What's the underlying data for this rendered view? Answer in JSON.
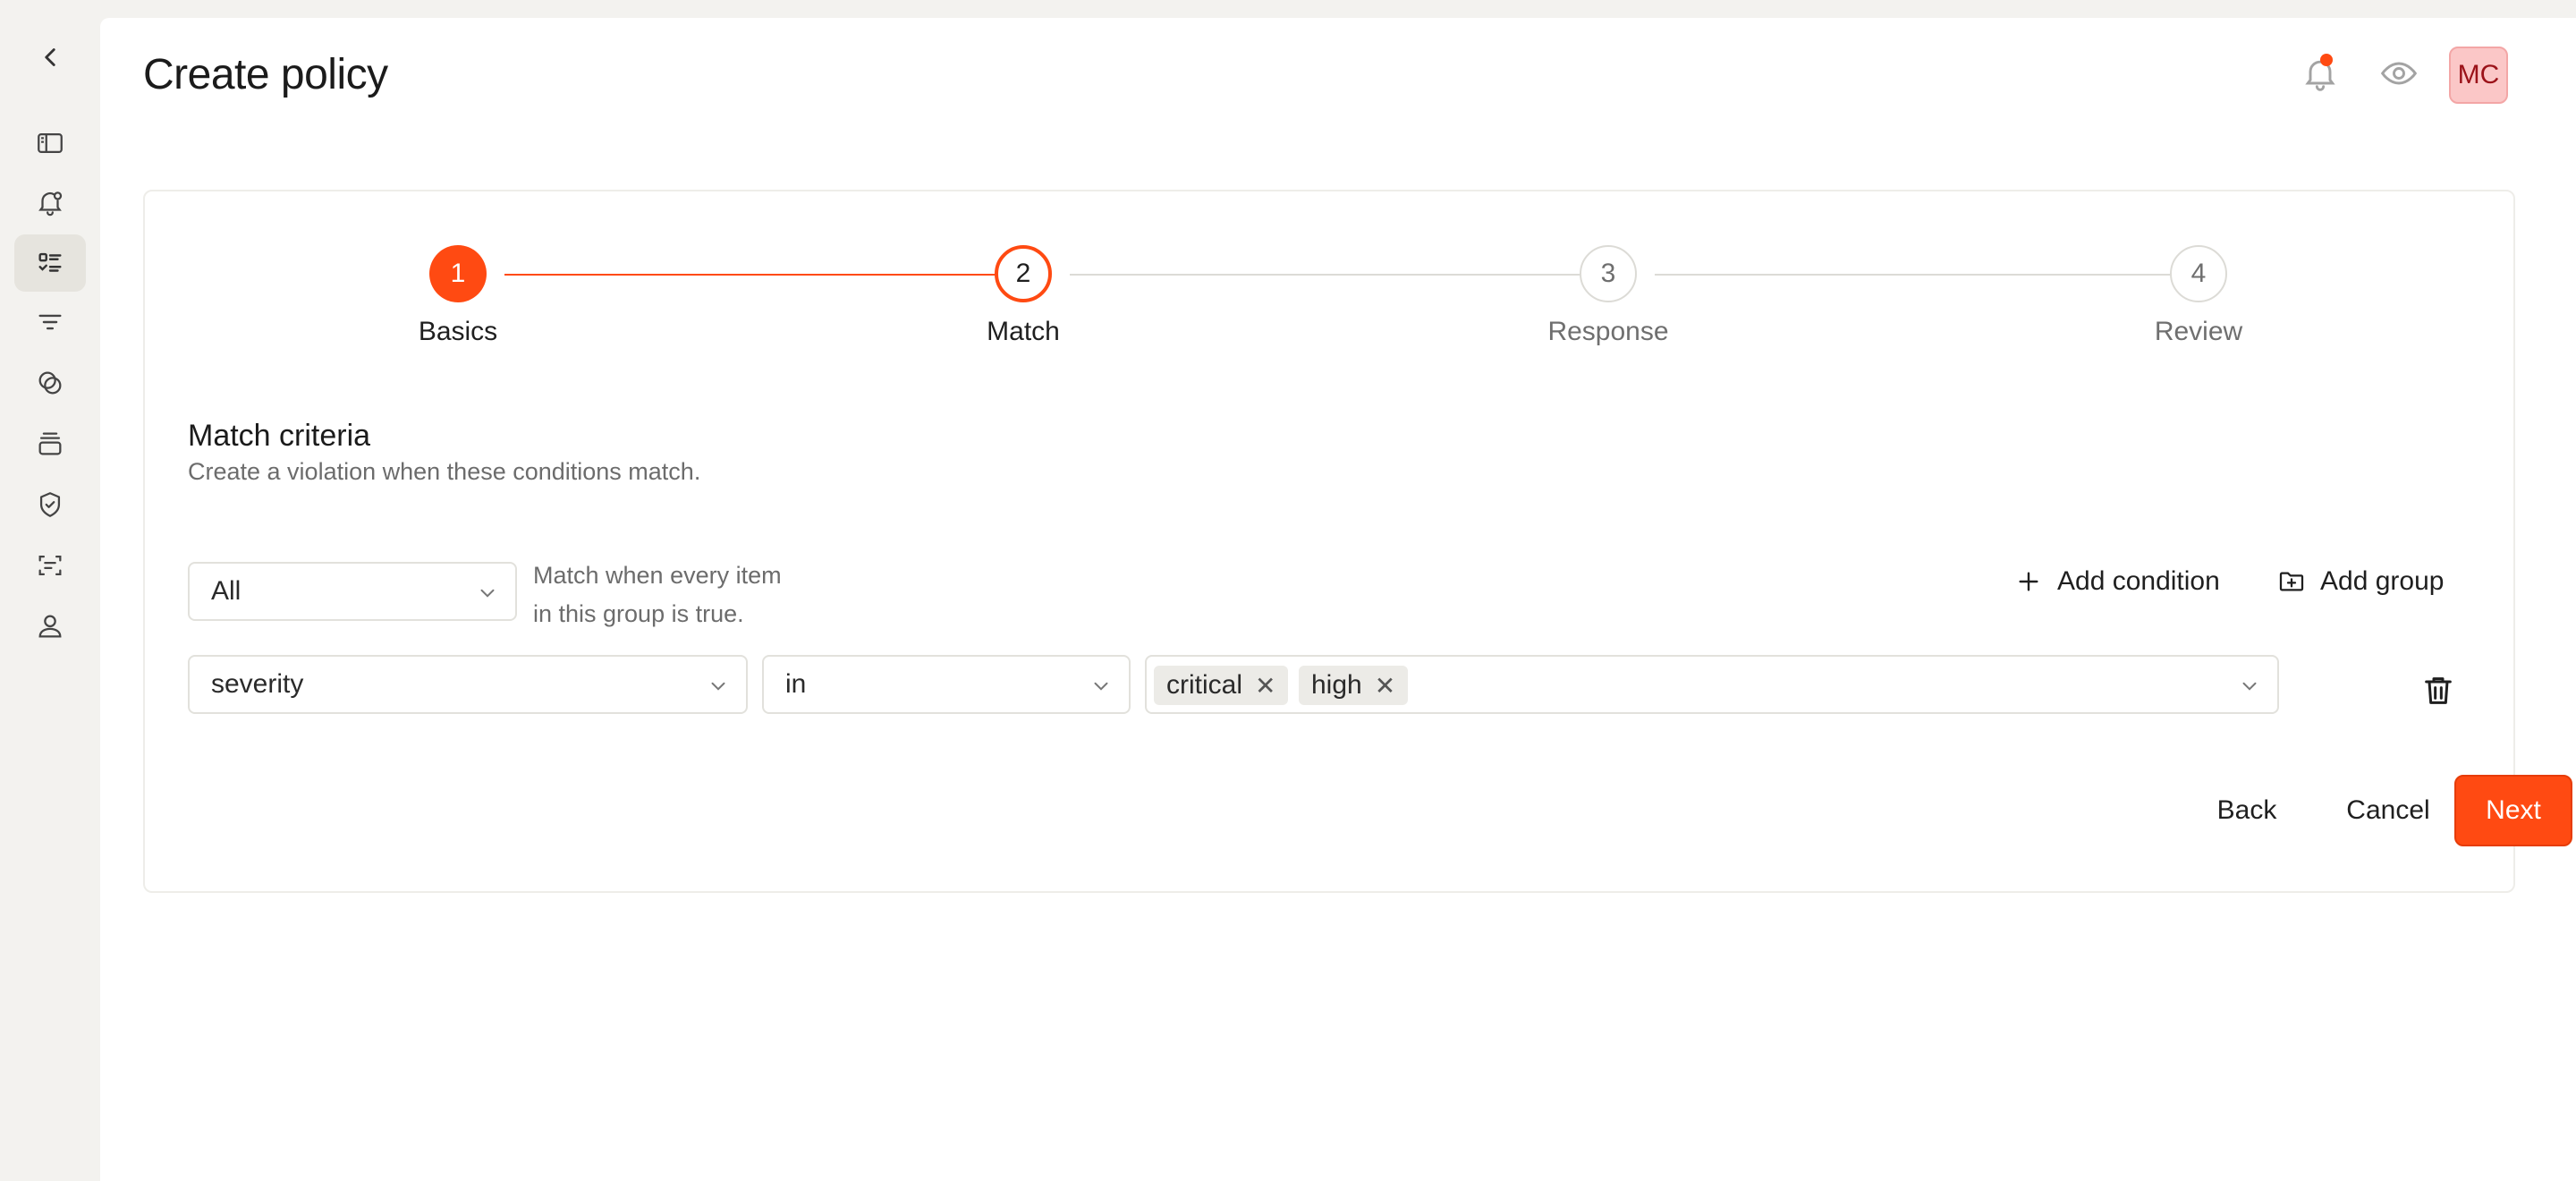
{
  "page": {
    "title": "Create policy"
  },
  "header": {
    "avatar_initials": "MC",
    "notification_dot_color": "#ff4a12"
  },
  "sidebar": {
    "items": [
      {
        "icon": "chevron-left-icon"
      },
      {
        "icon": "sidebar-toggle-icon"
      },
      {
        "icon": "alert-bell-icon"
      },
      {
        "icon": "checklist-icon",
        "active": true
      },
      {
        "icon": "filter-icon"
      },
      {
        "icon": "integrations-icon"
      },
      {
        "icon": "stack-icon"
      },
      {
        "icon": "shield-check-icon"
      },
      {
        "icon": "scan-icon"
      },
      {
        "icon": "user-icon"
      }
    ]
  },
  "stepper": {
    "accent_color": "#ff4a12",
    "steps": [
      {
        "number": "1",
        "label": "Basics",
        "state": "complete"
      },
      {
        "number": "2",
        "label": "Match",
        "state": "current"
      },
      {
        "number": "3",
        "label": "Response",
        "state": "upcoming"
      },
      {
        "number": "4",
        "label": "Review",
        "state": "upcoming"
      }
    ]
  },
  "match": {
    "title": "Match criteria",
    "description": "Create a violation when these conditions match.",
    "group_mode": "All",
    "helper_line1": "Match when every item",
    "helper_line2": "in this group is true.",
    "add_condition_label": "Add condition",
    "add_group_label": "Add group",
    "condition": {
      "field": "severity",
      "operator": "in",
      "values": [
        "critical",
        "high"
      ]
    }
  },
  "footer": {
    "back_label": "Back",
    "cancel_label": "Cancel",
    "next_label": "Next"
  }
}
